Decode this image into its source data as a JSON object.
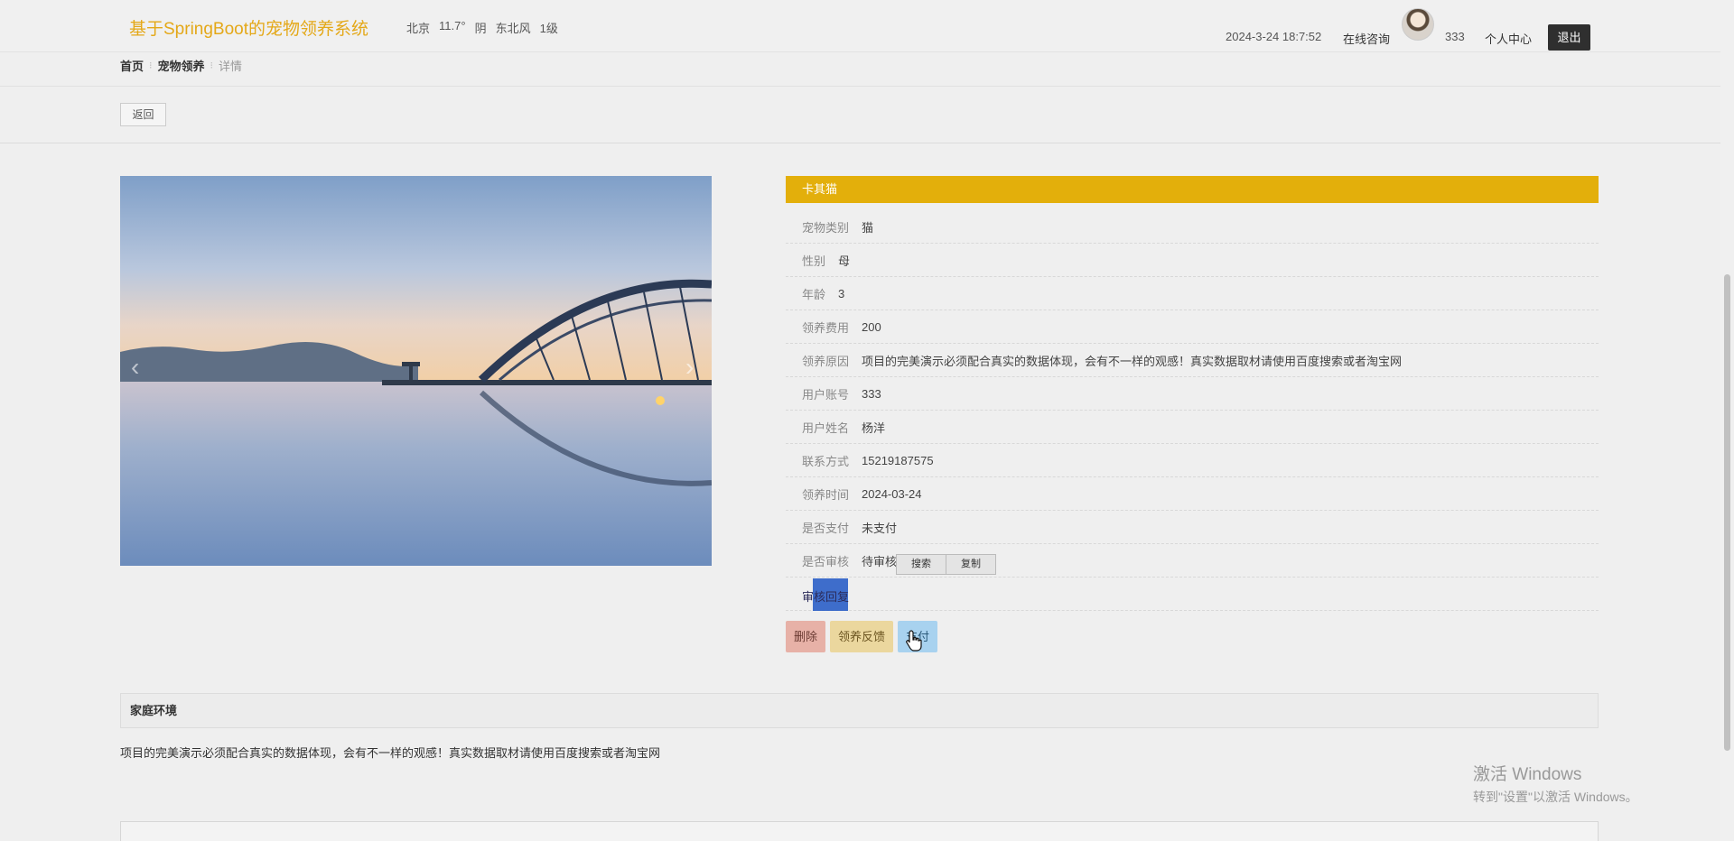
{
  "header": {
    "site_title": "基于SpringBoot的宠物领养系统",
    "weather": {
      "city": "北京",
      "temperature": "11.7°",
      "condition": "阴",
      "wind": "东北风",
      "level": "1级"
    },
    "datetime": "2024-3-24 18:7:52",
    "consult_label": "在线咨询",
    "username": "333",
    "personal_center_label": "个人中心",
    "logout_label": "退出"
  },
  "breadcrumb": {
    "home": "首页",
    "section": "宠物领养",
    "current": "详情",
    "separator": "⁝"
  },
  "back_label": "返回",
  "carousel": {
    "prev_icon": "‹",
    "next_icon": "›"
  },
  "detail": {
    "pet_name": "卡其猫",
    "rows": [
      {
        "label": "宠物类别",
        "value": "猫"
      },
      {
        "label": "性别",
        "value": "母"
      },
      {
        "label": "年龄",
        "value": "3"
      },
      {
        "label": "领养费用",
        "value": "200"
      },
      {
        "label": "领养原因",
        "value": "项目的完美演示必须配合真实的数据体现，会有不一样的观感！真实数据取材请使用百度搜索或者淘宝网"
      },
      {
        "label": "用户账号",
        "value": "333"
      },
      {
        "label": "用户姓名",
        "value": "杨洋"
      },
      {
        "label": "联系方式",
        "value": "15219187575"
      },
      {
        "label": "领养时间",
        "value": "2024-03-24"
      },
      {
        "label": "是否支付",
        "value": "未支付"
      },
      {
        "label": "是否审核",
        "value": "待审核"
      }
    ],
    "review_reply_label": "审核回复",
    "context_menu": {
      "search": "搜索",
      "copy": "复制"
    }
  },
  "actions": {
    "delete": "删除",
    "feedback": "领养反馈",
    "pay": "支付"
  },
  "home_env": {
    "title": "家庭环境",
    "content": "项目的完美演示必须配合真实的数据体现，会有不一样的观感！真实数据取材请使用百度搜索或者淘宝网"
  },
  "watermark": {
    "line1": "激活 Windows",
    "line2": "转到\"设置\"以激活 Windows。"
  },
  "colors": {
    "brand": "#e4a818",
    "header_bar": "#e3af0b",
    "delete": "#e7b1a7",
    "feedback": "#ebd79e",
    "pay": "#a8d2ef"
  }
}
